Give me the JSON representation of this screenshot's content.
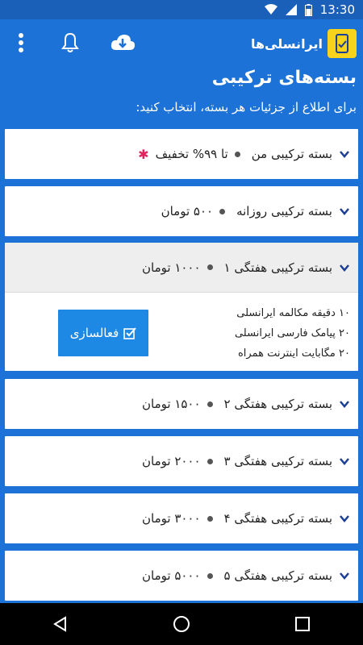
{
  "status_bar": {
    "time": "13:30"
  },
  "header": {
    "brand": "ایرانسلی‌ها",
    "title": "بسته‌های ترکیبی",
    "subtitle": "برای اطلاع از جزئیات هر بسته، انتخاب کنید:"
  },
  "packages": [
    {
      "name": "بسته ترکیبی من",
      "price": "تا ۹۹% تخفیف",
      "star": "✱"
    },
    {
      "name": "بسته ترکیبی روزانه",
      "price": "۵۰۰ تومان"
    },
    {
      "name": "بسته ترکیبی هفتگی ۱",
      "price": "۱۰۰۰ تومان",
      "features": [
        "۱۰ دقیقه مکالمه ایرانسلی",
        "۲۰ پیامک فارسی ایرانسلی",
        "۲۰ مگابایت اینترنت همراه"
      ],
      "activate_label": "فعالسازی"
    },
    {
      "name": "بسته ترکیبی هفتگی ۲",
      "price": "۱۵۰۰ تومان"
    },
    {
      "name": "بسته ترکیبی هفتگی ۳",
      "price": "۲۰۰۰ تومان"
    },
    {
      "name": "بسته ترکیبی هفتگی ۴",
      "price": "۳۰۰۰ تومان"
    },
    {
      "name": "بسته ترکیبی هفتگی ۵",
      "price": "۵۰۰۰ تومان"
    }
  ],
  "icons": {
    "menu": "overflow-menu-icon",
    "bell": "bell-icon",
    "download": "cloud-download-icon",
    "chevron": "chevron-down-icon",
    "check": "checkbox-icon"
  },
  "colors": {
    "primary": "#1c72d6",
    "button": "#1e88e5",
    "logo": "#f7d31b",
    "chevron": "#1c3f94",
    "star": "#e0245e"
  }
}
